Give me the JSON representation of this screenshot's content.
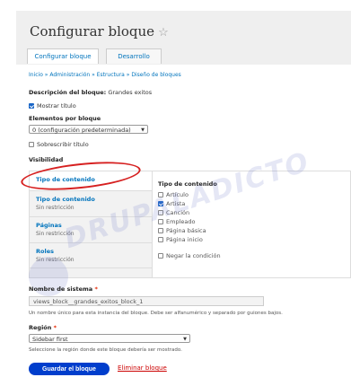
{
  "header": {
    "title": "Configurar bloque"
  },
  "tabs": [
    {
      "label": "Configurar bloque"
    },
    {
      "label": "Desarrollo"
    }
  ],
  "breadcrumb": "Inicio » Administración » Estructura » Diseño de bloques",
  "block_description": {
    "label": "Descripción del bloque:",
    "value": "Grandes exitos"
  },
  "show_title": {
    "label": "Mostrar título",
    "checked": true
  },
  "items_per_block": {
    "label": "Elementos por bloque",
    "value": "0 (configuración predeterminada)"
  },
  "override_title": {
    "label": "Sobrescribir título",
    "checked": false
  },
  "visibility": {
    "label": "Visibilidad",
    "vertical_tabs": [
      {
        "title": "Tipo de contenido",
        "summary": ""
      },
      {
        "title": "Tipo de contenido",
        "summary": "Sin restricción"
      },
      {
        "title": "Páginas",
        "summary": "Sin restricción"
      },
      {
        "title": "Roles",
        "summary": "Sin restricción"
      }
    ],
    "panel": {
      "title": "Tipo de contenido",
      "options": [
        {
          "label": "Artículo",
          "checked": false
        },
        {
          "label": "Artista",
          "checked": true
        },
        {
          "label": "Canción",
          "checked": false
        },
        {
          "label": "Empleado",
          "checked": false
        },
        {
          "label": "Página básica",
          "checked": false
        },
        {
          "label": "Página inicio",
          "checked": false
        }
      ],
      "negate": {
        "label": "Negar la condición",
        "checked": false
      }
    }
  },
  "machine_name": {
    "label": "Nombre de sistema",
    "value": "views_block__grandes_exitos_block_1",
    "help": "Un nombre único para esta instancia del bloque. Debe ser alfanumérico y separado por guiones bajos."
  },
  "region": {
    "label": "Región",
    "value": "Sidebar first",
    "help": "Seleccione la región donde este bloque debería ser mostrado."
  },
  "actions": {
    "save": "Guardar el bloque",
    "delete": "Eliminar bloque"
  },
  "watermark": "DRUPALADICTO",
  "colors": {
    "accent": "#003ecc",
    "link": "#0074bd",
    "highlight": "#d62020",
    "required": "#e62600"
  }
}
